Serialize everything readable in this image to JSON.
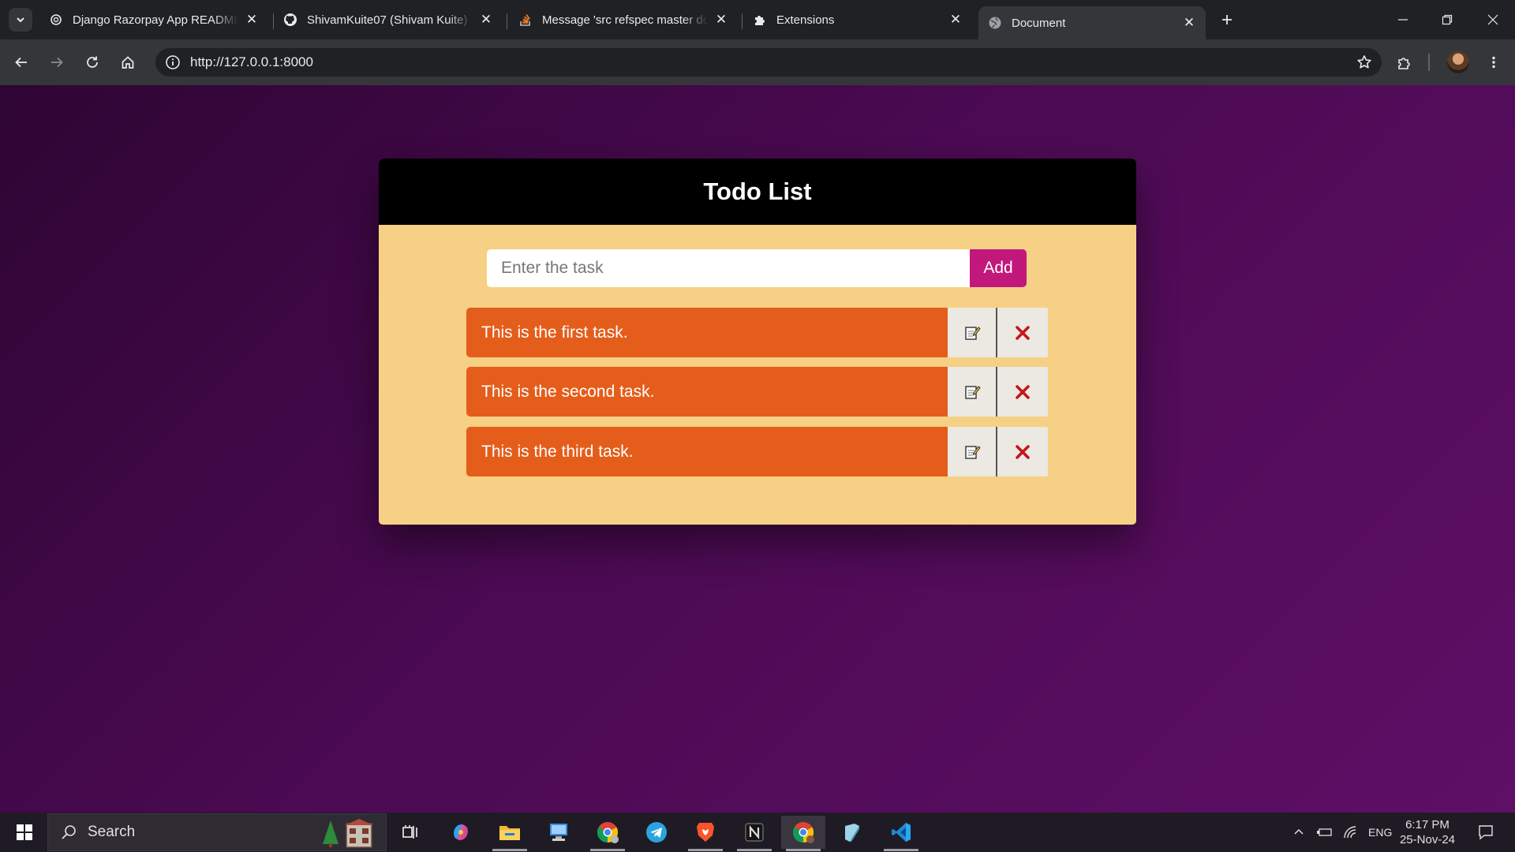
{
  "browser": {
    "tabs": [
      {
        "title": "Django Razorpay App README",
        "icon": "openai-icon"
      },
      {
        "title": "ShivamKuite07 (Shivam Kuite)",
        "icon": "github-icon"
      },
      {
        "title": "Message 'src refspec master do",
        "icon": "stackoverflow-icon"
      },
      {
        "title": "Extensions",
        "icon": "puzzle-icon"
      },
      {
        "title": "Document",
        "icon": "globe-icon",
        "active": true
      }
    ],
    "url": "http://127.0.0.1:8000"
  },
  "page": {
    "title": "Todo List",
    "input_placeholder": "Enter the task",
    "add_label": "Add",
    "tasks": [
      {
        "text": "This is the first task."
      },
      {
        "text": "This is the second task."
      },
      {
        "text": "This is the third task."
      }
    ],
    "colors": {
      "card_bg": "#f6d085",
      "header_bg": "#000000",
      "task_bg": "#e55d1b",
      "add_button_bg": "#c2187c",
      "page_bg_start": "#2e0533",
      "page_bg_end": "#5e0f66"
    }
  },
  "taskbar": {
    "search_label": "Search",
    "language": "ENG",
    "time": "6:17 PM",
    "date": "25-Nov-24"
  }
}
